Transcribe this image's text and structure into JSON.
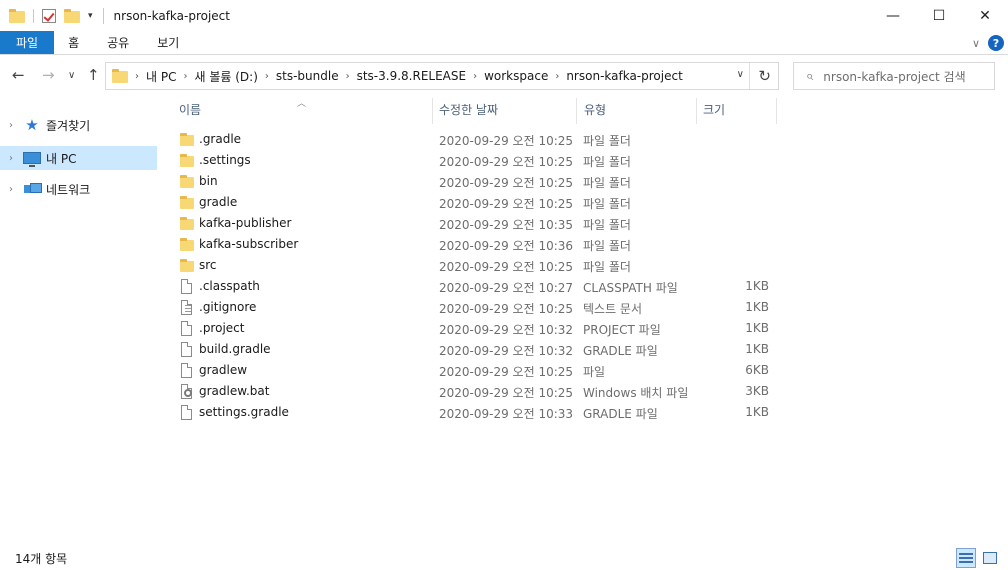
{
  "window": {
    "title": "nrson-kafka-project",
    "controls": {
      "minimize": "—",
      "maximize": "☐",
      "close": "✕"
    }
  },
  "ribbon": {
    "tabs": [
      "파일",
      "홈",
      "공유",
      "보기"
    ],
    "help": "?"
  },
  "address": {
    "crumbs": [
      "내 PC",
      "새 볼륨 (D:)",
      "sts-bundle",
      "sts-3.9.8.RELEASE",
      "workspace",
      "nrson-kafka-project"
    ],
    "search_placeholder": "nrson-kafka-project 검색"
  },
  "nav_pane": [
    {
      "label": "즐겨찾기",
      "icon": "star-icon",
      "selected": false
    },
    {
      "label": "내 PC",
      "icon": "pc-icon",
      "selected": true
    },
    {
      "label": "네트워크",
      "icon": "network-icon",
      "selected": false
    }
  ],
  "columns": {
    "name": "이름",
    "date": "수정한 날짜",
    "type": "유형",
    "size": "크기"
  },
  "files": [
    {
      "name": ".gradle",
      "date": "2020-09-29 오전 10:25",
      "type": "파일 폴더",
      "size": "",
      "icon": "folder-icon"
    },
    {
      "name": ".settings",
      "date": "2020-09-29 오전 10:25",
      "type": "파일 폴더",
      "size": "",
      "icon": "folder-icon"
    },
    {
      "name": "bin",
      "date": "2020-09-29 오전 10:25",
      "type": "파일 폴더",
      "size": "",
      "icon": "folder-icon"
    },
    {
      "name": "gradle",
      "date": "2020-09-29 오전 10:25",
      "type": "파일 폴더",
      "size": "",
      "icon": "folder-icon"
    },
    {
      "name": "kafka-publisher",
      "date": "2020-09-29 오전 10:35",
      "type": "파일 폴더",
      "size": "",
      "icon": "folder-icon"
    },
    {
      "name": "kafka-subscriber",
      "date": "2020-09-29 오전 10:36",
      "type": "파일 폴더",
      "size": "",
      "icon": "folder-icon"
    },
    {
      "name": "src",
      "date": "2020-09-29 오전 10:25",
      "type": "파일 폴더",
      "size": "",
      "icon": "folder-icon"
    },
    {
      "name": ".classpath",
      "date": "2020-09-29 오전 10:27",
      "type": "CLASSPATH 파일",
      "size": "1KB",
      "icon": "file-icon"
    },
    {
      "name": ".gitignore",
      "date": "2020-09-29 오전 10:25",
      "type": "텍스트 문서",
      "size": "1KB",
      "icon": "text-file-icon"
    },
    {
      "name": ".project",
      "date": "2020-09-29 오전 10:32",
      "type": "PROJECT 파일",
      "size": "1KB",
      "icon": "file-icon"
    },
    {
      "name": "build.gradle",
      "date": "2020-09-29 오전 10:32",
      "type": "GRADLE 파일",
      "size": "1KB",
      "icon": "file-icon"
    },
    {
      "name": "gradlew",
      "date": "2020-09-29 오전 10:25",
      "type": "파일",
      "size": "6KB",
      "icon": "file-icon"
    },
    {
      "name": "gradlew.bat",
      "date": "2020-09-29 오전 10:25",
      "type": "Windows 배치 파일",
      "size": "3KB",
      "icon": "batch-file-icon"
    },
    {
      "name": "settings.gradle",
      "date": "2020-09-29 오전 10:33",
      "type": "GRADLE 파일",
      "size": "1KB",
      "icon": "file-icon"
    }
  ],
  "status": {
    "count": "14개 항목"
  }
}
